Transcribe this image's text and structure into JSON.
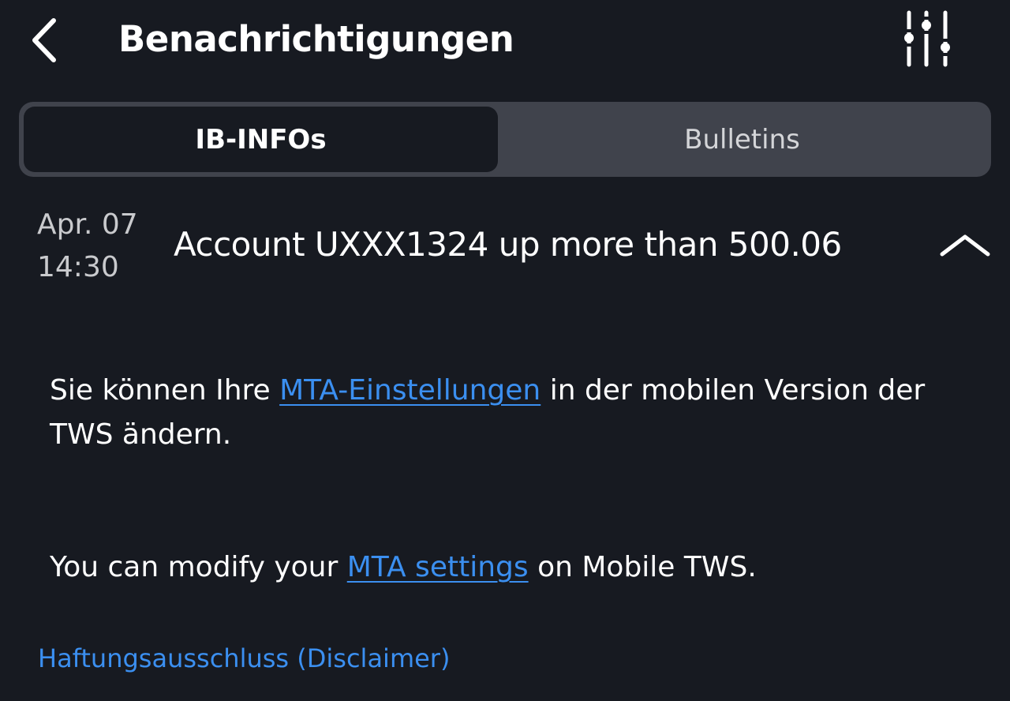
{
  "header": {
    "back_icon": "chevron-left-icon",
    "title": "Benachrichtigungen",
    "filter_icon": "sliders-icon"
  },
  "tabs": [
    {
      "label": "IB-INFOs",
      "active": true
    },
    {
      "label": "Bulletins",
      "active": false
    }
  ],
  "message": {
    "date": "Apr. 07",
    "time": "14:30",
    "title": "Account UXXX1324 up more than 500.06",
    "collapse_icon": "chevron-up-icon",
    "body_de": {
      "before": "Sie können Ihre ",
      "link": "MTA-Einstellungen",
      "after": " in der mobilen Version der TWS ändern."
    },
    "body_en": {
      "before": "You can modify your ",
      "link": "MTA settings",
      "after": " on Mobile TWS."
    }
  },
  "disclaimer": "Haftungsausschluss (Disclaimer)",
  "colors": {
    "background": "#171a21",
    "segment_track": "#40434c",
    "link": "#3b8ff0",
    "text": "#ffffff"
  }
}
